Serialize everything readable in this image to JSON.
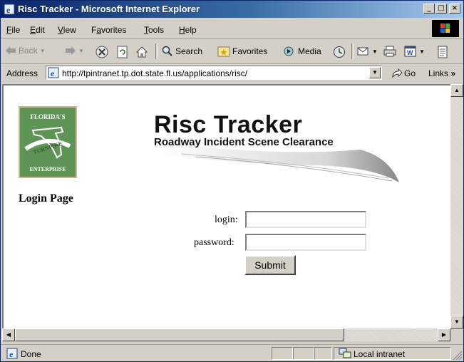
{
  "window": {
    "title": "Risc Tracker - Microsoft Internet Explorer"
  },
  "menubar": {
    "items": [
      "File",
      "Edit",
      "View",
      "Favorites",
      "Tools",
      "Help"
    ],
    "underline": [
      "F",
      "E",
      "V",
      "a",
      "T",
      "H"
    ]
  },
  "toolbar": {
    "back_label": "Back",
    "search_label": "Search",
    "favorites_label": "Favorites",
    "media_label": "Media"
  },
  "addressbar": {
    "label": "Address",
    "url": "http://tpintranet.tp.dot.state.fl.us/applications/risc/",
    "go_label": "Go",
    "links_label": "Links"
  },
  "page": {
    "logo": {
      "top": "FLORIDA'S",
      "middle": "TURNPIKE",
      "bottom": "ENTERPRISE"
    },
    "banner_title": "Risc Tracker",
    "banner_subtitle": "Roadway Incident Scene Clearance",
    "heading": "Login Page",
    "login_label": "login:",
    "login_value": "",
    "password_label": "password:",
    "password_value": "",
    "submit_label": "Submit"
  },
  "statusbar": {
    "text": "Done",
    "zone": "Local intranet"
  },
  "colors": {
    "titlebar_start": "#0a246a",
    "titlebar_end": "#a6caf0",
    "chrome": "#d4d0c8",
    "logo_green": "#5e9556"
  },
  "icons": [
    "ie-icon",
    "windows-logo-icon",
    "back-arrow-icon",
    "forward-arrow-icon",
    "stop-icon",
    "refresh-icon",
    "home-icon",
    "search-icon",
    "favorites-icon",
    "media-icon",
    "history-icon",
    "mail-icon",
    "print-icon",
    "edit-icon",
    "discuss-icon",
    "page-icon",
    "go-arrow-icon",
    "intranet-icon"
  ]
}
